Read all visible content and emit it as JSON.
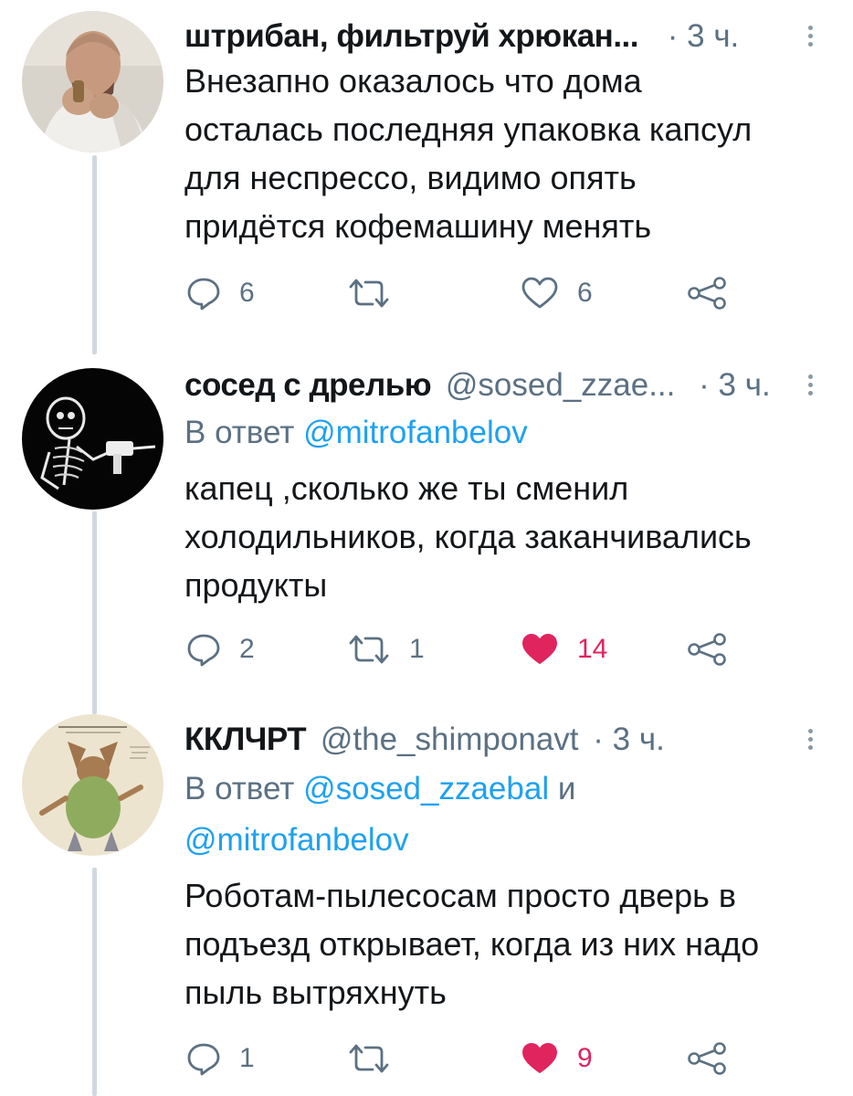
{
  "colors": {
    "link": "#1da1f2",
    "secondary": "#5b7083",
    "liked": "#e0245e",
    "thread_line": "#cfd9de"
  },
  "tweets": [
    {
      "avatar_icon": "user-avatar-man-drinking",
      "name": "штрибан, фильтруй хрюкан...",
      "handle": "",
      "dot": "·",
      "time": "3 ч.",
      "reply_prefix": "",
      "reply_mentions": [],
      "text_lines": [
        "Внезапно оказалось что дома",
        "осталась последняя упаковка капсул",
        "для неспрессо, видимо опять",
        "придётся кофемашину менять"
      ],
      "replies": "6",
      "retweets": "",
      "likes": "6",
      "liked": false
    },
    {
      "avatar_icon": "user-avatar-skeleton-drill",
      "name": "сосед с дрелью",
      "handle": "@sosed_zzae...",
      "dot": "·",
      "time": "3 ч.",
      "reply_prefix": "В ответ",
      "reply_mentions": [
        "@mitrofanbelov"
      ],
      "text_lines": [
        "капец ,сколько же ты сменил",
        "холодильников, когда заканчивались",
        "продукты"
      ],
      "replies": "2",
      "retweets": "1",
      "likes": "14",
      "liked": true
    },
    {
      "avatar_icon": "user-avatar-vintage-creature",
      "name": "ККЛЧРТ",
      "handle": "@the_shimponavt",
      "dot": "·",
      "time": "3 ч.",
      "reply_prefix": "В ответ",
      "reply_mentions": [
        "@sosed_zzaebal",
        "@mitrofanbelov"
      ],
      "reply_conjunction": "и",
      "text_lines": [
        "Роботам-пылесосам просто дверь в",
        "подъезд открывает, когда из них надо",
        "пыль вытряхнуть"
      ],
      "replies": "1",
      "retweets": "",
      "likes": "9",
      "liked": true
    }
  ]
}
